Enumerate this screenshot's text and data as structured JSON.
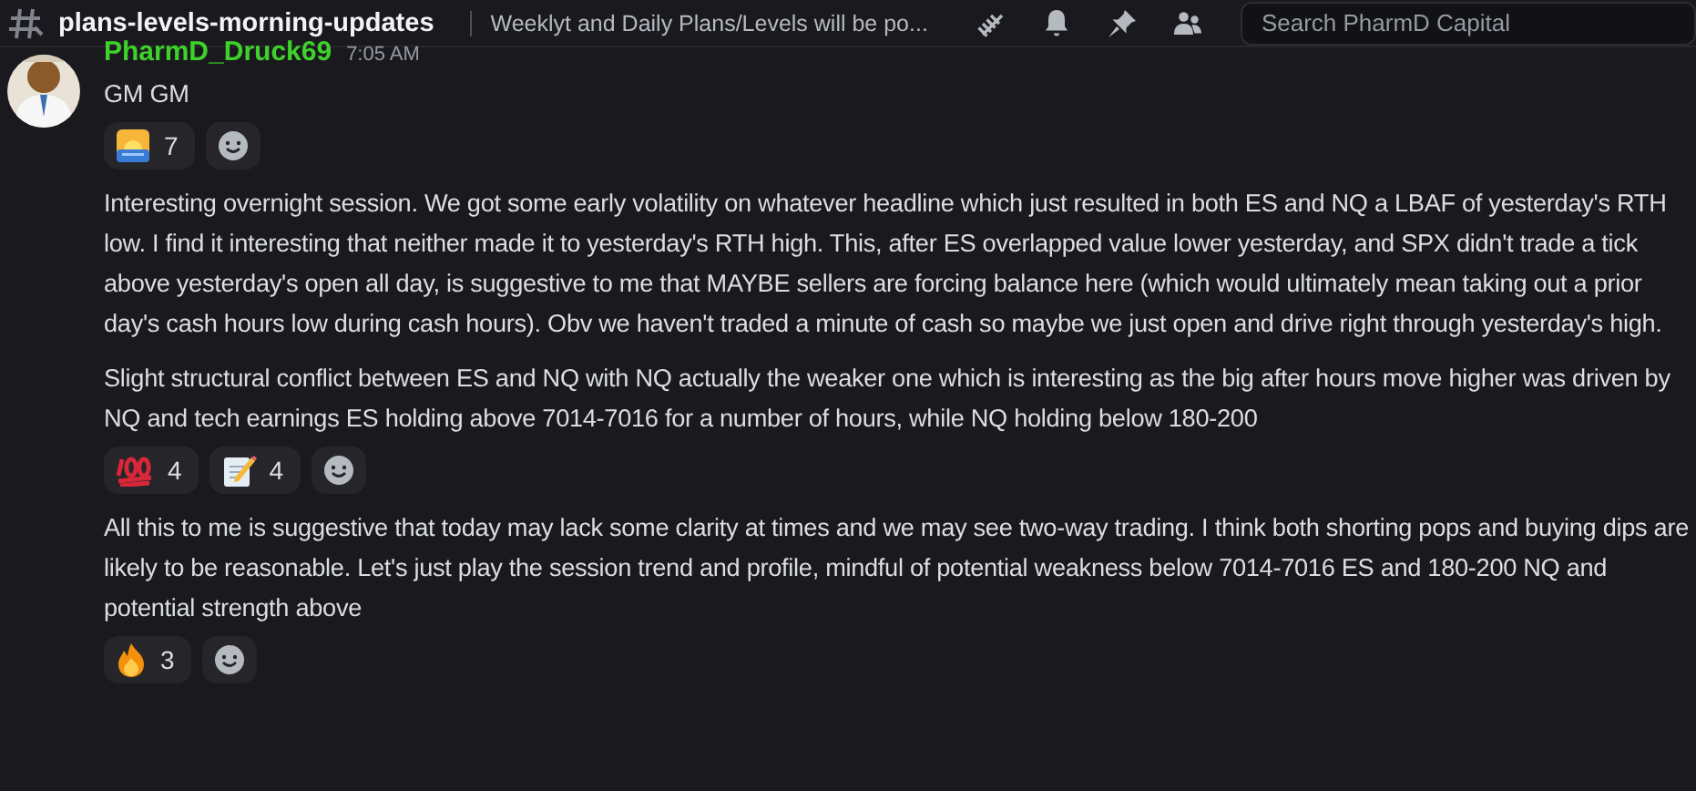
{
  "header": {
    "channel": "plans-levels-morning-updates",
    "topic": "Weeklyt and Daily Plans/Levels will be po...",
    "search": {
      "placeholder": "Search PharmD Capital"
    }
  },
  "author": {
    "name": "PharmD_Druck69",
    "time": "7:05 AM",
    "color": "#3fd12b"
  },
  "messages": [
    {
      "text": "GM GM",
      "reactions": [
        {
          "kind": "sunrise",
          "count": "7"
        }
      ]
    },
    {
      "text": "Interesting overnight session. We got some early volatility on whatever headline which just resulted in both ES and NQ a LBAF of yesterday's RTH low. I find it interesting that neither made it to yesterday's RTH high. This, after ES overlapped value lower yesterday, and SPX didn't trade a tick above yesterday's open all day, is suggestive to me that MAYBE sellers are forcing balance here (which would ultimately mean taking out a prior day's cash hours low during cash hours). Obv we haven't traded a minute of cash so maybe we just open and drive right through yesterday's high."
    },
    {
      "text": "Slight structural conflict between ES and NQ with NQ actually the weaker one which is interesting as the big after hours move higher was driven by NQ and tech earnings ES holding above 7014-7016 for a number of hours, while NQ holding below 180-200",
      "reactions": [
        {
          "kind": "hundred",
          "count": "4"
        },
        {
          "kind": "memo",
          "count": "4"
        }
      ]
    },
    {
      "text": "All this to me is suggestive that today may lack some clarity at times and we may see two-way trading. I think both shorting pops and buying dips are likely to be reasonable. Let's just play the session trend and profile, mindful of potential weakness below 7014-7016 ES and 180-200 NQ and potential strength above",
      "reactions": [
        {
          "kind": "fire",
          "count": "3"
        }
      ]
    }
  ]
}
